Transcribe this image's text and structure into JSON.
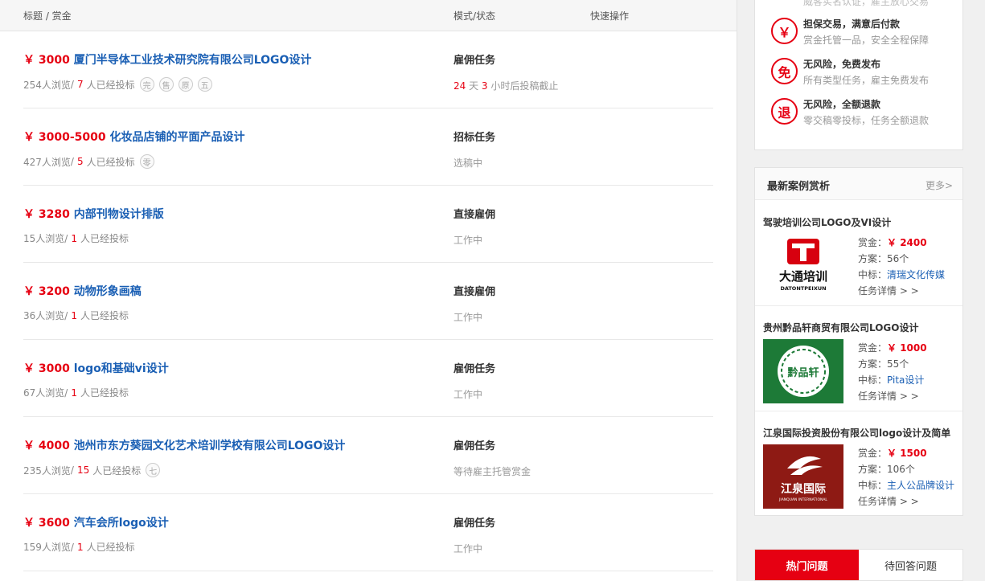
{
  "header": {
    "col_title": "标题 / 赏金",
    "col_mode": "模式/状态",
    "col_action": "快速操作"
  },
  "tasks": [
    {
      "price": "￥ 3000",
      "title": "厦门半导体工业技术研究院有限公司LOGO设计",
      "views": "254人浏览",
      "sep": " / ",
      "bids": "7",
      "bids_suffix": "人已经投标",
      "badges": [
        "完",
        "售",
        "原",
        "五"
      ],
      "mode": "雇佣任务",
      "status_a": "24",
      "status_b": " 天 ",
      "status_c": "3",
      "status_d": " 小时后投稿截止"
    },
    {
      "price": "￥ 3000-5000",
      "title": "化妆品店铺的平面产品设计",
      "views": "427人浏览",
      "sep": " / ",
      "bids": "5",
      "bids_suffix": "人已经投标",
      "badges": [
        "零"
      ],
      "mode": "招标任务",
      "status": "选稿中"
    },
    {
      "price": "￥ 3280",
      "title": "内部刊物设计排版",
      "views": "15人浏览",
      "sep": " / ",
      "bids": "1",
      "bids_suffix": "人已经投标",
      "badges": [],
      "mode": "直接雇佣",
      "status": "工作中"
    },
    {
      "price": "￥ 3200",
      "title": "动物形象画稿",
      "views": "36人浏览",
      "sep": " / ",
      "bids": "1",
      "bids_suffix": "人已经投标",
      "badges": [],
      "mode": "直接雇佣",
      "status": "工作中"
    },
    {
      "price": "￥ 3000",
      "title": "logo和基础vi设计",
      "views": "67人浏览",
      "sep": " / ",
      "bids": "1",
      "bids_suffix": "人已经投标",
      "badges": [],
      "mode": "雇佣任务",
      "status": "工作中"
    },
    {
      "price": "￥ 4000",
      "title": "池州市东方葵园文化艺术培训学校有限公司LOGO设计",
      "views": "235人浏览",
      "sep": " / ",
      "bids": "15",
      "bids_suffix": "人已经投标",
      "badges": [
        "七"
      ],
      "mode": "雇佣任务",
      "status": "等待雇主托管赏金"
    },
    {
      "price": "￥ 3600",
      "title": "汽车会所logo设计",
      "views": "159人浏览",
      "sep": " / ",
      "bids": "1",
      "bids_suffix": "人已经投标",
      "badges": [],
      "mode": "雇佣任务",
      "status": "工作中"
    }
  ],
  "guarantees": [
    {
      "icon": "￥",
      "title": "担保交易，满意后付款",
      "desc": "赏金托管一品，安全全程保障"
    },
    {
      "icon": "免",
      "title": "无风险，免费发布",
      "desc": "所有类型任务，雇主免费发布"
    },
    {
      "icon": "退",
      "title": "无风险，全额退款",
      "desc": "零交稿零投标，任务全额退款"
    }
  ],
  "guarantee_top_partial": "威客实名认证，雇主放心交易",
  "cases": {
    "title": "最新案例赏析",
    "more": "更多>",
    "items": [
      {
        "title": "驾驶培训公司LOGO及VI设计",
        "reward_label": "赏金：",
        "reward": "￥ 2400",
        "plans": "方案：56个",
        "winner_label": "中标：",
        "winner": "清瑞文化传媒",
        "detail": "任务详情 > >",
        "logo_text": "大通培训",
        "logo_sub": "DATONTPEIXUN"
      },
      {
        "title": "贵州黔品轩商贸有限公司LOGO设计",
        "reward_label": "赏金：",
        "reward": "￥ 1000",
        "plans": "方案：55个",
        "winner_label": "中标：",
        "winner": "Pita设计",
        "detail": "任务详情 > >",
        "logo_text": "黔品轩"
      },
      {
        "title": "江泉国际投资股份有限公司logo设计及简单",
        "reward_label": "赏金：",
        "reward": "￥ 1500",
        "plans": "方案：106个",
        "winner_label": "中标：",
        "winner": "主人公品牌设计",
        "detail": "任务详情 > >",
        "logo_text": "江泉国际",
        "logo_sub": "JIANQUAN INTERNATIONAL"
      }
    ]
  },
  "tabs": [
    {
      "label": "热门问题"
    },
    {
      "label": "待回答问题"
    }
  ],
  "colors": {
    "accent": "#e60012",
    "link": "#1a5fb4"
  }
}
